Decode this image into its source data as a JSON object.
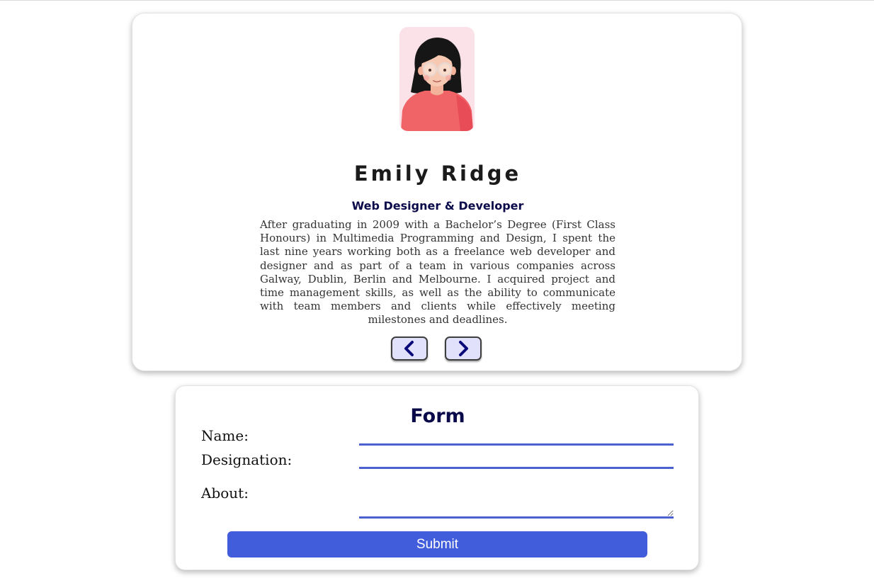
{
  "profile": {
    "name": "Emily Ridge",
    "role": "Web Designer & Developer",
    "bio": "After graduating in 2009 with a Bachelor’s Degree (First Class Honours) in Multimedia Programming and Design, I spent the last nine years working both as a freelance web developer and designer and as part of a team in various companies across Galway, Dublin, Berlin and Melbourne. I acquired project and time management skills, as well as the ability to communicate with team members and clients while effectively meeting milestones and deadlines.",
    "avatar_icon": "woman-with-glasses-avatar",
    "prev_icon": "chevron-left-icon",
    "next_icon": "chevron-right-icon"
  },
  "form": {
    "title": "Form",
    "name_label": "Name:",
    "name_value": "",
    "designation_label": "Designation:",
    "designation_value": "",
    "about_label": "About:",
    "about_value": "",
    "submit_label": "Submit"
  },
  "colors": {
    "accent": "#415ddb",
    "input_underline": "#4a5fd0",
    "nav_button_bg": "#e1e1fb",
    "heading_navy": "#0a0a4a"
  }
}
